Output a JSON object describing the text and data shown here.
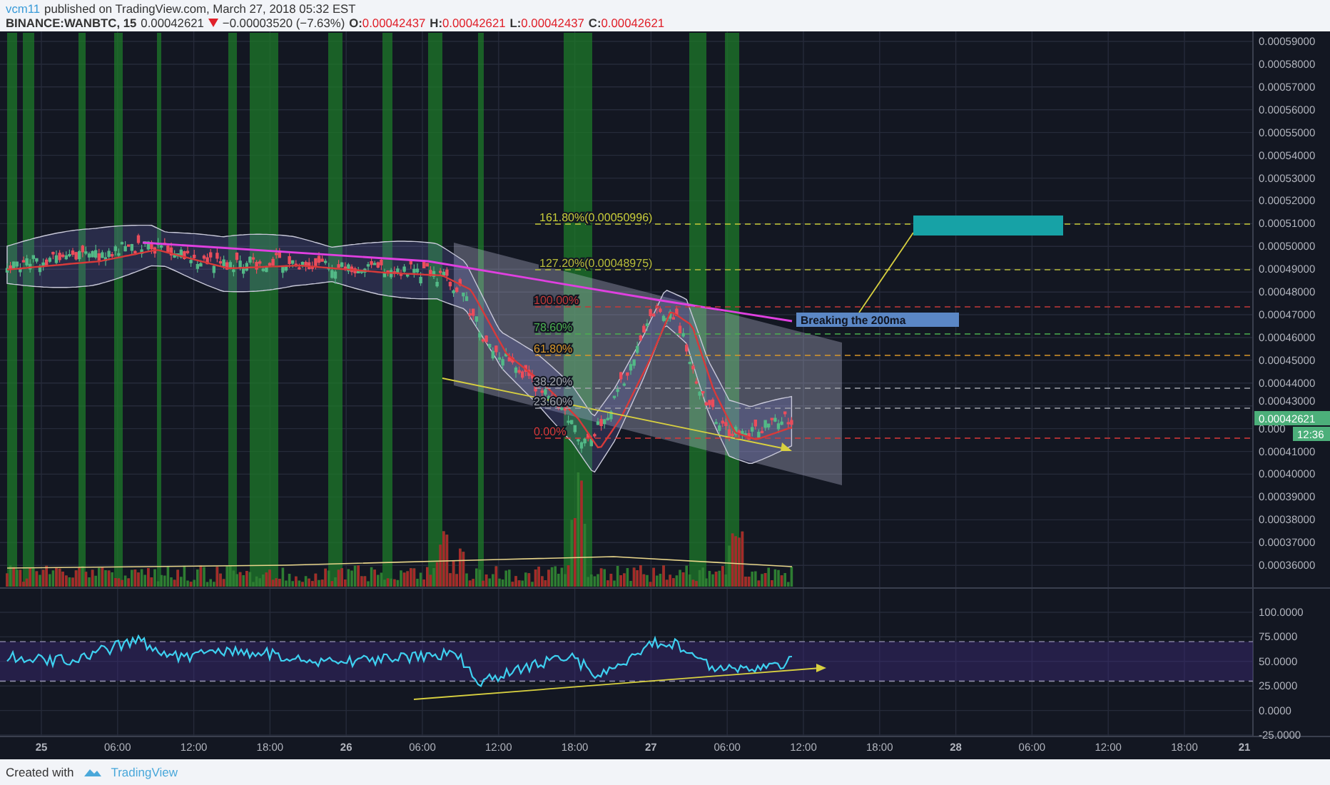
{
  "header": {
    "author": "vcm11",
    "published": "published on TradingView.com, March 27, 2018 05:32 EST",
    "symbol": "BINANCE:WANBTC, 15",
    "last": "0.00042621",
    "falling": true,
    "change": "−0.00003520 (−7.63%)",
    "ohlc": [
      {
        "label": "O:",
        "value": "0.00042437"
      },
      {
        "label": "H:",
        "value": "0.00042621"
      },
      {
        "label": "L:",
        "value": "0.00042437"
      },
      {
        "label": "C:",
        "value": "0.00042621"
      }
    ]
  },
  "price_pane": {
    "axis_labels": [
      "0.00059000",
      "0.00058000",
      "0.00057000",
      "0.00056000",
      "0.00055000",
      "0.00054000",
      "0.00053000",
      "0.00052000",
      "0.00051000",
      "0.00050000",
      "0.00049000",
      "0.00048000",
      "0.00047000",
      "0.00046000",
      "0.00045000",
      "0.00044000",
      "0.00043000",
      "0.000",
      "0.00041000",
      "0.00040000",
      "0.00039000",
      "0.00038000",
      "0.00037000",
      "0.00036000"
    ],
    "last_price_tag": "0.00042621",
    "countdown_tag": "12:36",
    "fib_levels": [
      {
        "label": "161.80%(0.00050996)",
        "color": "#c8cc3a"
      },
      {
        "label": "127.20%(0.00048975)",
        "color": "#b8bc3a"
      },
      {
        "label": "100.00%",
        "color": "#c23a3a"
      },
      {
        "label": "78.60%",
        "color": "#4caf50"
      },
      {
        "label": "61.80%",
        "color": "#d8962a"
      },
      {
        "label": "38.20%",
        "color": "#a0a3ab"
      },
      {
        "label": "23.60%",
        "color": "#a0a3ab"
      },
      {
        "label": "0.00%",
        "color": "#d93a3a"
      }
    ],
    "callout": "Breaking the 200ma"
  },
  "rsi_pane": {
    "axis_labels": [
      "100.0000",
      "75.0000",
      "50.0000",
      "25.0000",
      "0.0000",
      "-25.0000"
    ]
  },
  "time_axis": [
    "25",
    "06:00",
    "12:00",
    "18:00",
    "26",
    "06:00",
    "12:00",
    "18:00",
    "27",
    "06:00",
    "12:00",
    "18:00",
    "28",
    "06:00",
    "12:00",
    "18:00",
    "21"
  ],
  "footer": {
    "created_with": "Created with",
    "brand": "TradingView"
  }
}
